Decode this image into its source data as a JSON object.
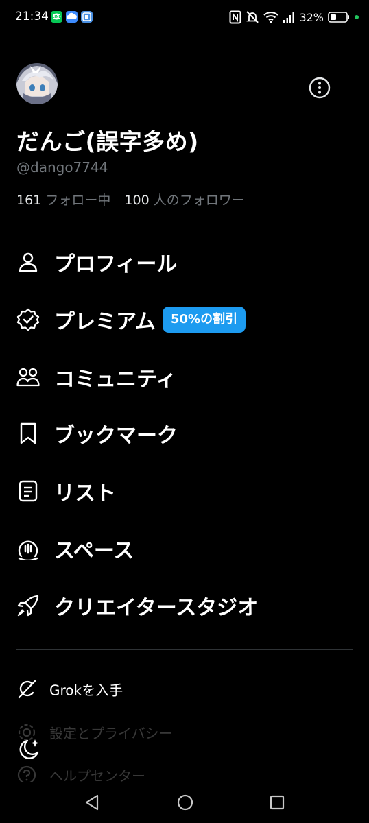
{
  "status_bar": {
    "time": "21:34",
    "battery_percent": "32%",
    "notification_icons": [
      "line-icon",
      "cloud-icon",
      "app-icon"
    ],
    "right_icons": [
      "nfc-icon",
      "mute-icon",
      "wifi-icon",
      "signal-icon",
      "battery-icon"
    ]
  },
  "profile": {
    "display_name": "だんご(誤字多め)",
    "handle": "@dango7744",
    "following_count": "161",
    "following_label": "フォロー中",
    "followers_count": "100",
    "followers_label": "人のフォロワー"
  },
  "menu": {
    "profile": "プロフィール",
    "premium": "プレミアム",
    "premium_badge": "50%の割引",
    "communities": "コミュニティ",
    "bookmarks": "ブックマーク",
    "lists": "リスト",
    "spaces": "スペース",
    "creator_studio": "クリエイタースタジオ"
  },
  "secondary": {
    "grok": "Grokを入手",
    "settings": "設定とプライバシー",
    "help": "ヘルプセンター"
  },
  "colors": {
    "background": "#000000",
    "text_primary": "#e7e9ea",
    "text_secondary": "#71767b",
    "accent": "#1d9bf0",
    "divider": "#2f3336"
  }
}
